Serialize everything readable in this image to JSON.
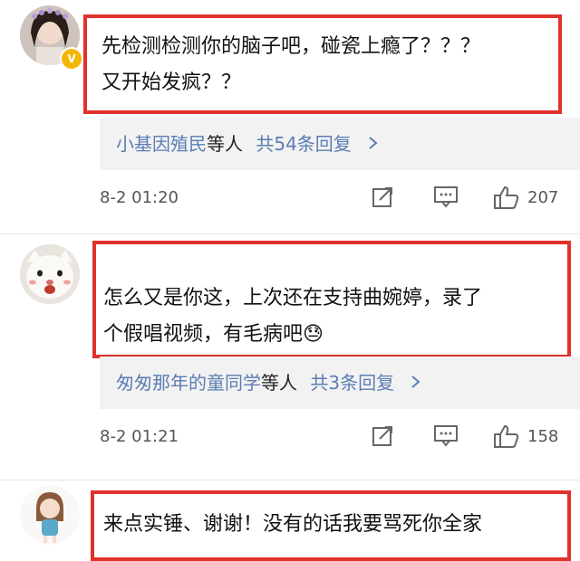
{
  "comments": [
    {
      "text": "先检测检测你的脑子吧，碰瓷上瘾了？？？\n又开始发疯？？",
      "reply_names": "小基因殖民",
      "reply_etc": "等人",
      "reply_count": "共54条回复",
      "timestamp": "8-2 01:20",
      "likes": "207",
      "verified_badge": "V"
    },
    {
      "text": "怎么又是你这，上次还在支持曲婉婷，录了\n个假唱视频，有毛病吧😓",
      "reply_names": "匆匆那年的童同学",
      "reply_etc": "等人",
      "reply_count": "共3条回复",
      "timestamp": "8-2 01:21",
      "likes": "158"
    },
    {
      "text": "来点实锤、谢谢！没有的话我要骂死你全家"
    }
  ],
  "icons": {
    "share": "share-icon",
    "comment": "comment-icon",
    "like": "thumbs-up-icon",
    "chevron": "chevron-right-icon"
  },
  "colors": {
    "highlight": "#e0312c",
    "link": "#5b7db3",
    "reply_bg": "#f2f2f2",
    "badge": "#f2b705"
  }
}
